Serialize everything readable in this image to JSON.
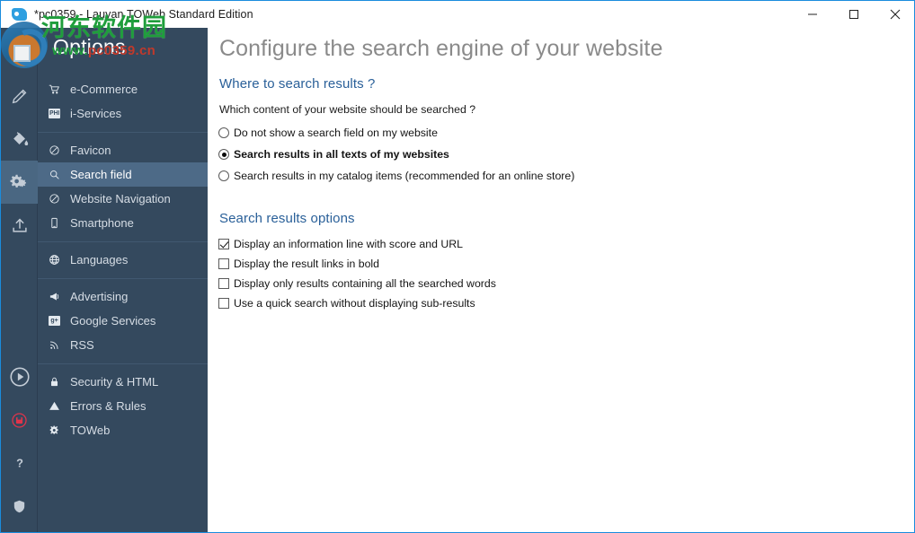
{
  "window": {
    "title": "*pc0359 - Lauyan TOWeb Standard Edition",
    "app_icon": "fish-app-icon",
    "controls": {
      "minimize": "minimize-icon",
      "maximize": "maximize-icon",
      "close": "close-icon"
    },
    "accent_border": "#1a8cdd"
  },
  "watermark": {
    "cn_text": "河东软件园",
    "url_prefix": "www.",
    "url_highlight": "pc0359",
    "url_suffix": ".cn",
    "green": "#1f9e3c",
    "red": "#c0392b"
  },
  "rail": {
    "top_icons": [
      {
        "name": "pencil-edit-icon",
        "active": false
      },
      {
        "name": "paint-bucket-icon",
        "active": false
      },
      {
        "name": "gears-options-icon",
        "active": true
      },
      {
        "name": "upload-publish-icon",
        "active": false
      }
    ],
    "bottom_icons": [
      {
        "name": "play-preview-icon",
        "active": false
      },
      {
        "name": "save-icon",
        "active": false
      },
      {
        "name": "help-question-icon",
        "active": false
      },
      {
        "name": "shield-icon",
        "active": false
      }
    ],
    "background": "#34495e",
    "active_background": "#4a6782"
  },
  "sidebar": {
    "title": "Options",
    "selected": "Search field",
    "groups": [
      {
        "items": [
          {
            "label": "e-Commerce",
            "icon": "shopping-cart-icon"
          },
          {
            "label": "i-Services",
            "icon": "php-badge-icon"
          }
        ]
      },
      {
        "items": [
          {
            "label": "Favicon",
            "icon": "circle-slash-icon"
          },
          {
            "label": "Search field",
            "icon": "magnifier-icon"
          },
          {
            "label": "Website Navigation",
            "icon": "circle-slash-icon"
          },
          {
            "label": "Smartphone",
            "icon": "smartphone-icon"
          }
        ]
      },
      {
        "items": [
          {
            "label": "Languages",
            "icon": "globe-icon"
          }
        ]
      },
      {
        "items": [
          {
            "label": "Advertising",
            "icon": "megaphone-icon"
          },
          {
            "label": "Google Services",
            "icon": "google-plus-badge-icon"
          },
          {
            "label": "RSS",
            "icon": "rss-icon"
          }
        ]
      },
      {
        "items": [
          {
            "label": "Security & HTML",
            "icon": "lock-icon"
          },
          {
            "label": "Errors & Rules",
            "icon": "warning-triangle-icon"
          },
          {
            "label": "TOWeb",
            "icon": "gear-icon"
          }
        ]
      }
    ]
  },
  "main": {
    "page_title": "Configure the search engine of your website",
    "heading_color": "#2a6099",
    "sections": [
      {
        "heading": "Where to search results ?",
        "question": "Which content of your website should be searched ?",
        "radios": [
          {
            "label": "Do not show a search field on my website",
            "checked": false
          },
          {
            "label": "Search results in all texts of my websites",
            "checked": true
          },
          {
            "label": "Search results in my catalog items (recommended for an online store)",
            "checked": false
          }
        ]
      },
      {
        "heading": "Search results options",
        "checkboxes": [
          {
            "label": "Display an information line with score and URL",
            "checked": true
          },
          {
            "label": "Display the result links in bold",
            "checked": false
          },
          {
            "label": "Display only results containing all the searched words",
            "checked": false
          },
          {
            "label": "Use a quick search without displaying sub-results",
            "checked": false
          }
        ]
      }
    ]
  }
}
